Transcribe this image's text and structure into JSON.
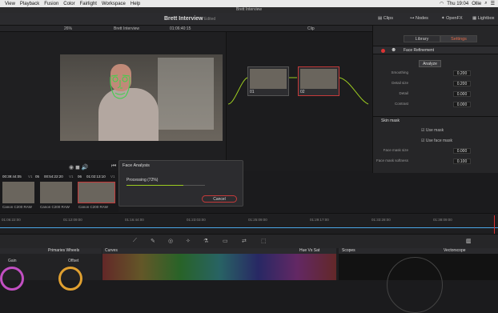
{
  "menubar": {
    "app_items": [
      "View",
      "Playback",
      "Fusion",
      "Color",
      "Fairlight",
      "Workspace",
      "Help"
    ],
    "user": "Ollie",
    "clock": "Thu 19:04"
  },
  "window": {
    "title": "Brett Interview"
  },
  "toolbar": {
    "project": "Brett Interview",
    "status": "Edited",
    "clips": "Clips",
    "nodes": "Nodes",
    "openfx": "OpenFX",
    "lightbox": "Lightbox"
  },
  "viewer_bar": {
    "zoom": "26%",
    "clip_name": "Brett Interview",
    "timecode": "01:06:40:15",
    "mode": "Clip"
  },
  "inspector": {
    "tabs": [
      "Library",
      "Settings"
    ],
    "section": "Face Refinement",
    "analyze": "Analyze",
    "rows": [
      {
        "label": "Smoothing",
        "value": "0.200"
      },
      {
        "label": "Detail size",
        "value": "0.200"
      },
      {
        "label": "Detail",
        "value": "0.000"
      },
      {
        "label": "Contrast",
        "value": "0.000"
      }
    ],
    "skin_mask": "Skin mask",
    "use_mask": "Use mask",
    "use_face_mask": "Use face mask",
    "mask_rows": [
      {
        "label": "Face mask size",
        "value": "0.000"
      },
      {
        "label": "Face mask softness",
        "value": "0.100"
      }
    ]
  },
  "nodes": [
    {
      "num": "01"
    },
    {
      "num": "02"
    }
  ],
  "dialog": {
    "title": "Face Analysis",
    "status": "Processing",
    "percent": "(72%)",
    "progress": 0.72,
    "cancel": "Cancel"
  },
  "clips": [
    {
      "tc": "00:39:44:05",
      "track": "V1",
      "label": "Canon C200 RAW"
    },
    {
      "tc": "00:54:22:20",
      "track": "V1",
      "label": "Canon C200 RAW"
    },
    {
      "tc": "01:02:13:10",
      "track": "V1",
      "label": "Canon C200 RAW"
    }
  ],
  "clip_nums": [
    "05",
    "06"
  ],
  "timeline_ticks": [
    "01:06:22:00",
    "01:12:09:00",
    "01:16:44:00",
    "01:23:03:00",
    "01:25:09:00",
    "01:29:17:00",
    "01:33:28:00",
    "01:38:09:00"
  ],
  "panels": {
    "primaries": "Primaries Wheels",
    "gain": "Gain",
    "offset": "Offset",
    "curves": "Curves",
    "huevsat": "Hue Vs Sat",
    "scopes": "Scopes",
    "vectorscope": "Vectorscope"
  }
}
